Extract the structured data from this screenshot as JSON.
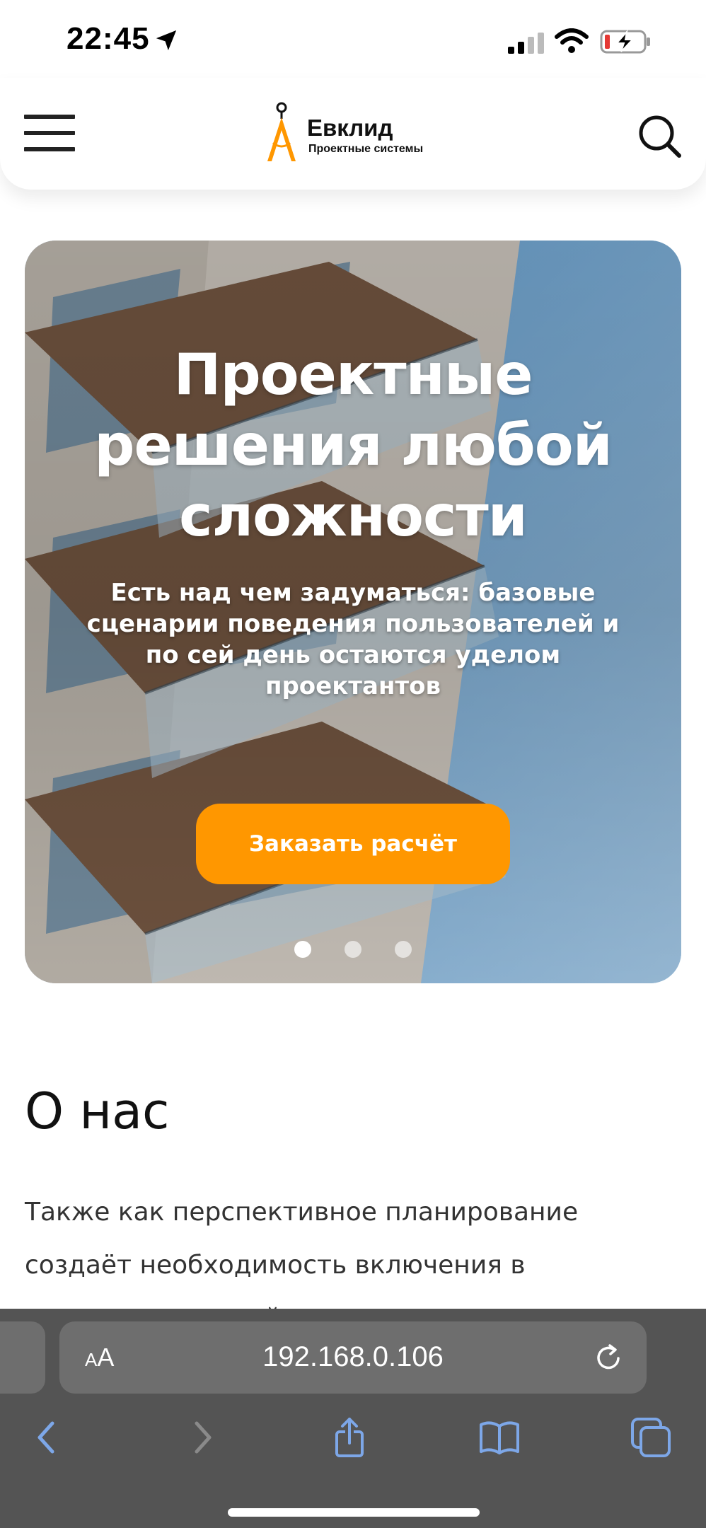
{
  "status_bar": {
    "time": "22:45"
  },
  "header": {
    "logo_title": "Евклид",
    "logo_subtitle": "Проектные системы"
  },
  "hero": {
    "title": "Проектные решения любой сложности",
    "subtitle": "Есть над чем задуматься: базовые сценарии поведения пользователей и по сей день остаются уделом проектантов",
    "cta_label": "Заказать расчёт",
    "slide_count": 3,
    "active_slide": 1
  },
  "about": {
    "title": "О нас",
    "text": "Также как перспективное планирование создаёт необходимость включения в производственный план целого ряда"
  },
  "browser": {
    "text_size_label": "AA",
    "url": "192.168.0.106"
  },
  "colors": {
    "accent": "#ff9700",
    "browser_bar": "#545454",
    "toolbar_icons": "#7da7e8"
  }
}
